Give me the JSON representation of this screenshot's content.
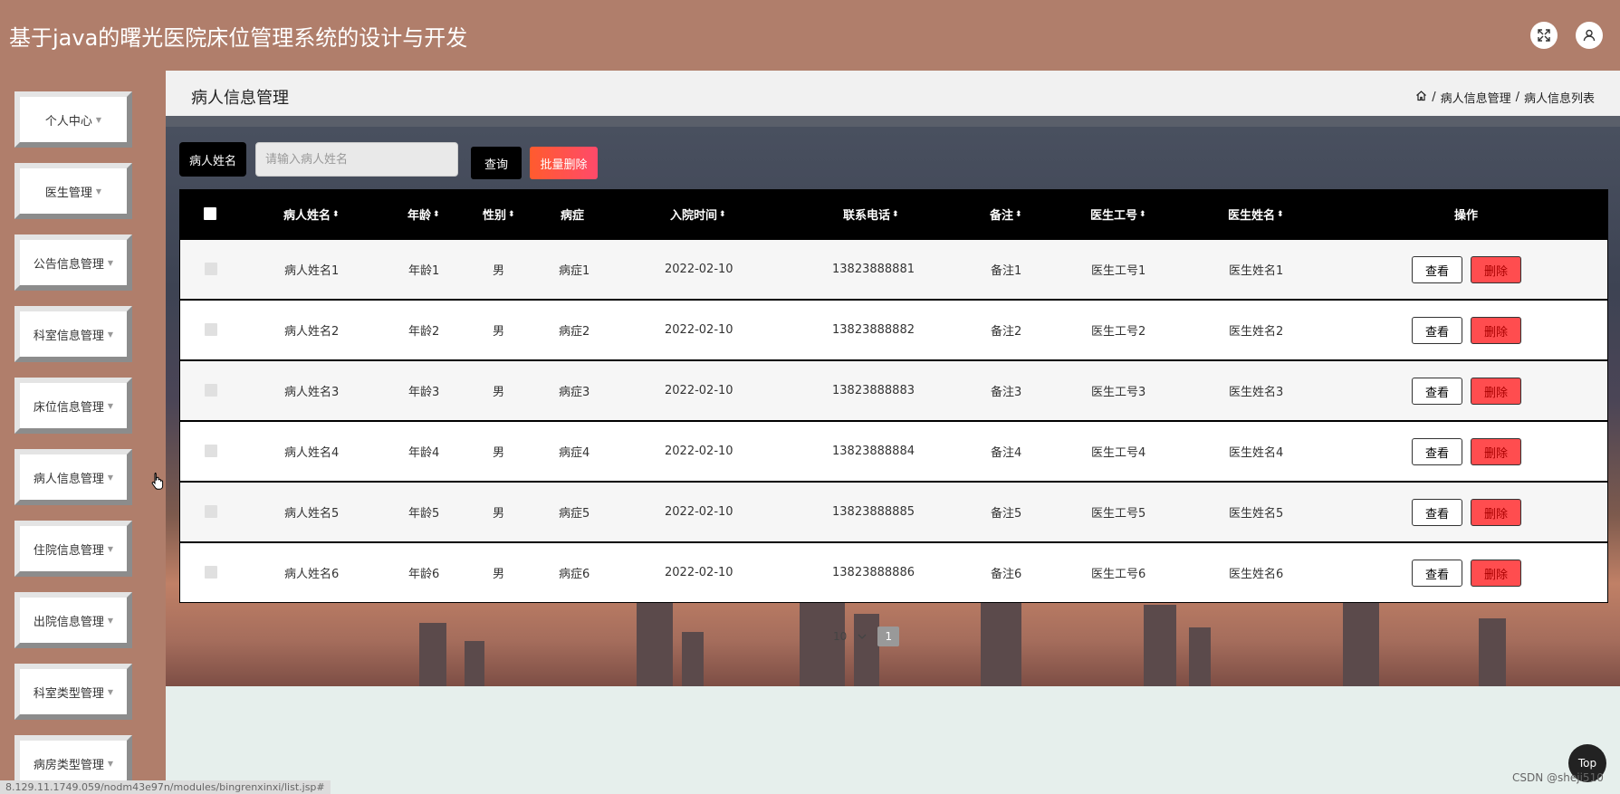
{
  "header": {
    "app_title": "基于java的曙光医院床位管理系统的设计与开发",
    "icons": [
      "fullscreen-icon",
      "user-icon"
    ]
  },
  "sidebar": {
    "items": [
      {
        "label": "个人中心"
      },
      {
        "label": "医生管理"
      },
      {
        "label": "公告信息管理"
      },
      {
        "label": "科室信息管理"
      },
      {
        "label": "床位信息管理"
      },
      {
        "label": "病人信息管理"
      },
      {
        "label": "住院信息管理"
      },
      {
        "label": "出院信息管理"
      },
      {
        "label": "科室类型管理"
      },
      {
        "label": "病房类型管理"
      }
    ]
  },
  "content_header": {
    "title": "病人信息管理",
    "breadcrumb": [
      "病人信息管理",
      "病人信息列表"
    ],
    "separator": "/"
  },
  "search": {
    "label": "病人姓名",
    "placeholder": "请输入病人姓名",
    "value": "",
    "query_label": "查询",
    "batch_delete_label": "批量删除"
  },
  "table": {
    "columns": [
      "病人姓名",
      "年龄",
      "性别",
      "病症",
      "入院时间",
      "联系电话",
      "备注",
      "医生工号",
      "医生姓名",
      "操作"
    ],
    "sortable": [
      true,
      true,
      true,
      false,
      true,
      true,
      true,
      true,
      true,
      false
    ],
    "rows": [
      {
        "name": "病人姓名1",
        "age": "年龄1",
        "gender": "男",
        "disease": "病症1",
        "admit_time": "2022-02-10",
        "phone": "13823888881",
        "note": "备注1",
        "doctor_id": "医生工号1",
        "doctor_name": "医生姓名1"
      },
      {
        "name": "病人姓名2",
        "age": "年龄2",
        "gender": "男",
        "disease": "病症2",
        "admit_time": "2022-02-10",
        "phone": "13823888882",
        "note": "备注2",
        "doctor_id": "医生工号2",
        "doctor_name": "医生姓名2"
      },
      {
        "name": "病人姓名3",
        "age": "年龄3",
        "gender": "男",
        "disease": "病症3",
        "admit_time": "2022-02-10",
        "phone": "13823888883",
        "note": "备注3",
        "doctor_id": "医生工号3",
        "doctor_name": "医生姓名3"
      },
      {
        "name": "病人姓名4",
        "age": "年龄4",
        "gender": "男",
        "disease": "病症4",
        "admit_time": "2022-02-10",
        "phone": "13823888884",
        "note": "备注4",
        "doctor_id": "医生工号4",
        "doctor_name": "医生姓名4"
      },
      {
        "name": "病人姓名5",
        "age": "年龄5",
        "gender": "男",
        "disease": "病症5",
        "admit_time": "2022-02-10",
        "phone": "13823888885",
        "note": "备注5",
        "doctor_id": "医生工号5",
        "doctor_name": "医生姓名5"
      },
      {
        "name": "病人姓名6",
        "age": "年龄6",
        "gender": "男",
        "disease": "病症6",
        "admit_time": "2022-02-10",
        "phone": "13823888886",
        "note": "备注6",
        "doctor_id": "医生工号6",
        "doctor_name": "医生姓名6"
      }
    ],
    "view_label": "查看",
    "delete_label": "删除"
  },
  "pagination": {
    "page_size": "10",
    "current_page": "1"
  },
  "back_to_top_label": "Top",
  "watermark": "CSDN @sheji510",
  "status_url": "8.129.11.1749.059/nodm43e97n/modules/bingrenxinxi/list.jsp#",
  "colors": {
    "header_bg": "#b07e6b",
    "table_header_bg": "#000000",
    "danger": "#ff4d4f"
  }
}
